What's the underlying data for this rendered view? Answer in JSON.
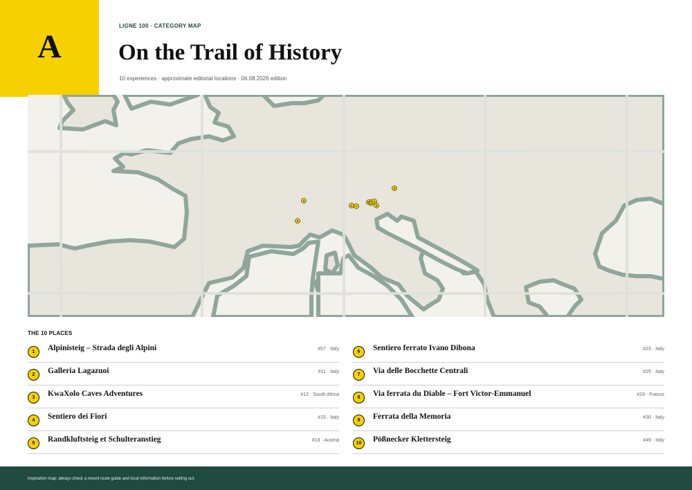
{
  "header": {
    "logo_letter": "A",
    "kicker": "LIGNE 100 · CATEGORY MAP",
    "title": "On the Trail of History",
    "subtitle": "10 experiences · approximate editorial locations · 06.08.2026 edition"
  },
  "colors": {
    "accent_yellow": "#f6d102",
    "brand_green": "#1f4a3e",
    "coastline": "#8fa69b",
    "land": "#e8e5dd",
    "sea": "#f2f1ec",
    "grid": "#dfe2dc"
  },
  "map": {
    "markers": [
      {
        "num": "1",
        "label": "1"
      },
      {
        "num": "2",
        "label": "2"
      },
      {
        "num": "3",
        "label": "3"
      },
      {
        "num": "4",
        "label": "4"
      },
      {
        "num": "5",
        "label": "5"
      },
      {
        "num": "6",
        "label": "6"
      },
      {
        "num": "7",
        "label": "7"
      },
      {
        "num": "8",
        "label": "8"
      },
      {
        "num": "9",
        "label": "9"
      },
      {
        "num": "10",
        "label": "10"
      }
    ]
  },
  "list": {
    "heading": "THE 10 PLACES",
    "items": [
      {
        "num": "1",
        "name": "Alpinisteig – Strada degli Alpini",
        "meta": "#07 · Italy"
      },
      {
        "num": "2",
        "name": "Galleria Lagazuoi",
        "meta": "#11 · Italy"
      },
      {
        "num": "3",
        "name": "KwaXolo Caves Adventures",
        "meta": "#12 · South Africa"
      },
      {
        "num": "4",
        "name": "Sentiero dei Fiori",
        "meta": "#15 · Italy"
      },
      {
        "num": "5",
        "name": "Randkluftsteig et Schulteranstieg",
        "meta": "#18 · Austria"
      },
      {
        "num": "6",
        "name": "Sentiero ferrato Ivano Dibona",
        "meta": "#23 · Italy"
      },
      {
        "num": "7",
        "name": "Via delle Bocchette Centrali",
        "meta": "#25 · Italy"
      },
      {
        "num": "8",
        "name": "Via ferrata du Diable – Fort Victor-Emmanuel",
        "meta": "#29 · France"
      },
      {
        "num": "9",
        "name": "Ferrata della Memoria",
        "meta": "#30 · Italy"
      },
      {
        "num": "10",
        "name": "Pößnecker Klettersteig",
        "meta": "#49 · Italy"
      }
    ]
  },
  "footer": {
    "note": "Inspiration map: always check a recent route guide and local information before setting out."
  }
}
